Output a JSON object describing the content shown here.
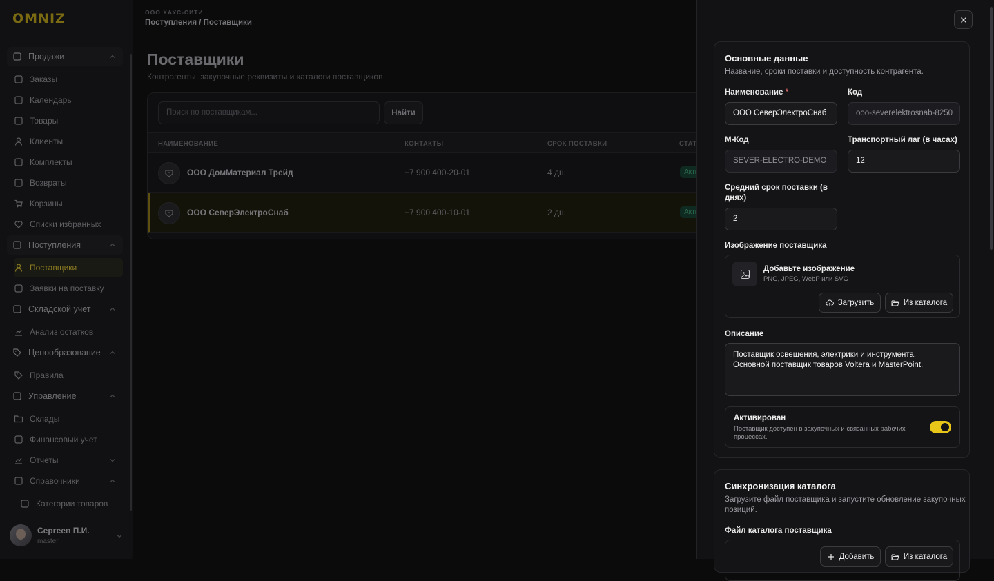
{
  "app": {
    "logo": "OMNIZ"
  },
  "sidebar": {
    "items": [
      {
        "label": "Продажи",
        "icon": "store-icon"
      },
      {
        "label": "Заказы",
        "icon": "orders-icon"
      },
      {
        "label": "Календарь",
        "icon": "calendar-icon"
      },
      {
        "label": "Товары",
        "icon": "box-icon"
      },
      {
        "label": "Клиенты",
        "icon": "user-icon"
      },
      {
        "label": "Комплекты",
        "icon": "layers-icon"
      },
      {
        "label": "Возвраты",
        "icon": "return-icon"
      },
      {
        "label": "Корзины",
        "icon": "cart-icon"
      },
      {
        "label": "Списки избранных",
        "icon": "heart-icon"
      },
      {
        "label": "Поступления",
        "icon": "inbox-icon"
      },
      {
        "label": "Поставщики",
        "icon": "supplier-icon"
      },
      {
        "label": "Заявки на поставку",
        "icon": "inbox-icon"
      },
      {
        "label": "Складской учет",
        "icon": "warehouse-icon"
      },
      {
        "label": "Анализ остатков",
        "icon": "chart-icon"
      },
      {
        "label": "Ценообразование",
        "icon": "tag-icon"
      },
      {
        "label": "Правила",
        "icon": "tag-icon"
      },
      {
        "label": "Управление",
        "icon": "layout-icon"
      },
      {
        "label": "Склады",
        "icon": "folder-icon"
      },
      {
        "label": "Финансовый учет",
        "icon": "wallet-icon"
      },
      {
        "label": "Отчеты",
        "icon": "bar-chart-icon"
      },
      {
        "label": "Справочники",
        "icon": "book-icon"
      },
      {
        "label": "Категории товаров",
        "icon": "tree-icon"
      }
    ],
    "user": {
      "name": "Сергеев П.И.",
      "role": "master"
    }
  },
  "topbar": {
    "org": "ООО ХАУС-СИТИ",
    "breadcrumb": "Поступления / Поставщики"
  },
  "page": {
    "title": "Поставщики",
    "subtitle": "Контрагенты, закупочные реквизиты и каталоги поставщиков",
    "search_placeholder": "Поиск по поставщикам...",
    "find_label": "Найти",
    "columns": [
      "НАИМЕНОВАНИЕ",
      "КОНТАКТЫ",
      "СРОК ПОСТАВКИ",
      "СТАТ"
    ],
    "rows": [
      {
        "name": "ООО ДомМатериал Трейд",
        "contact": "+7 900 400-20-01",
        "lead": "4 дн.",
        "status": "Акти"
      },
      {
        "name": "ООО СеверЭлектроСнаб",
        "contact": "+7 900 400-10-01",
        "lead": "2 дн.",
        "status": "Акти"
      }
    ]
  },
  "drawer": {
    "basic": {
      "title": "Основные данные",
      "subtitle": "Название, сроки поставки и доступность контрагента.",
      "name_label": "Наименование",
      "name_required": "*",
      "name_value": "ООО СеверЭлектроСнаб",
      "code_label": "Код",
      "code_value": "ooo-severelektrosnab-8250",
      "mcode_label": "М-Код",
      "mcode_value": "SEVER-ELECTRO-DEMO",
      "lag_label": "Транспортный лаг (в часах)",
      "lag_value": "12",
      "avg_label_1": "Средний срок поставки (в",
      "avg_label_2": "днях)",
      "avg_value": "2",
      "image_label": "Изображение поставщика",
      "image_title": "Добавьте изображение",
      "image_formats": "PNG, JPEG, WebP или SVG",
      "upload_label": "Загрузить",
      "catalog_label": "Из каталога",
      "desc_label": "Описание",
      "desc_value": "Поставщик освещения, электрики и инструмента. Основной поставщик товаров Voltera и MasterPoint.",
      "active_title": "Активирован",
      "active_sub": "Поставщик доступен в закупочных и связанных рабочих процессах.",
      "active_on": true
    },
    "sync": {
      "title": "Синхронизация каталога",
      "subtitle_1": "Загрузите файл поставщика и запустите обновление закупочных",
      "subtitle_2": "позиций.",
      "file_label": "Файл каталога поставщика",
      "add_label": "Добавить",
      "catalog_label": "Из каталога"
    },
    "accent": "#e8c619"
  }
}
